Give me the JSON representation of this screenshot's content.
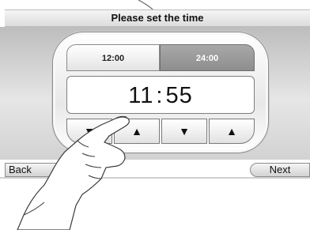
{
  "screen": {
    "title": "Please set the time"
  },
  "format_tabs": {
    "tab_12": "12:00",
    "tab_24": "24:00",
    "selected": "24:00"
  },
  "time": {
    "hours": "11",
    "separator": ":",
    "minutes": "55"
  },
  "controls": {
    "hour_down": "▼",
    "hour_up": "▲",
    "minute_down": "▼",
    "minute_up": "▲"
  },
  "navigation": {
    "back_label": "Back",
    "next_label": "Next"
  },
  "colors": {
    "selected_tab": "#9a9a9a",
    "panel": "#dcdcdc",
    "text": "#111111"
  }
}
